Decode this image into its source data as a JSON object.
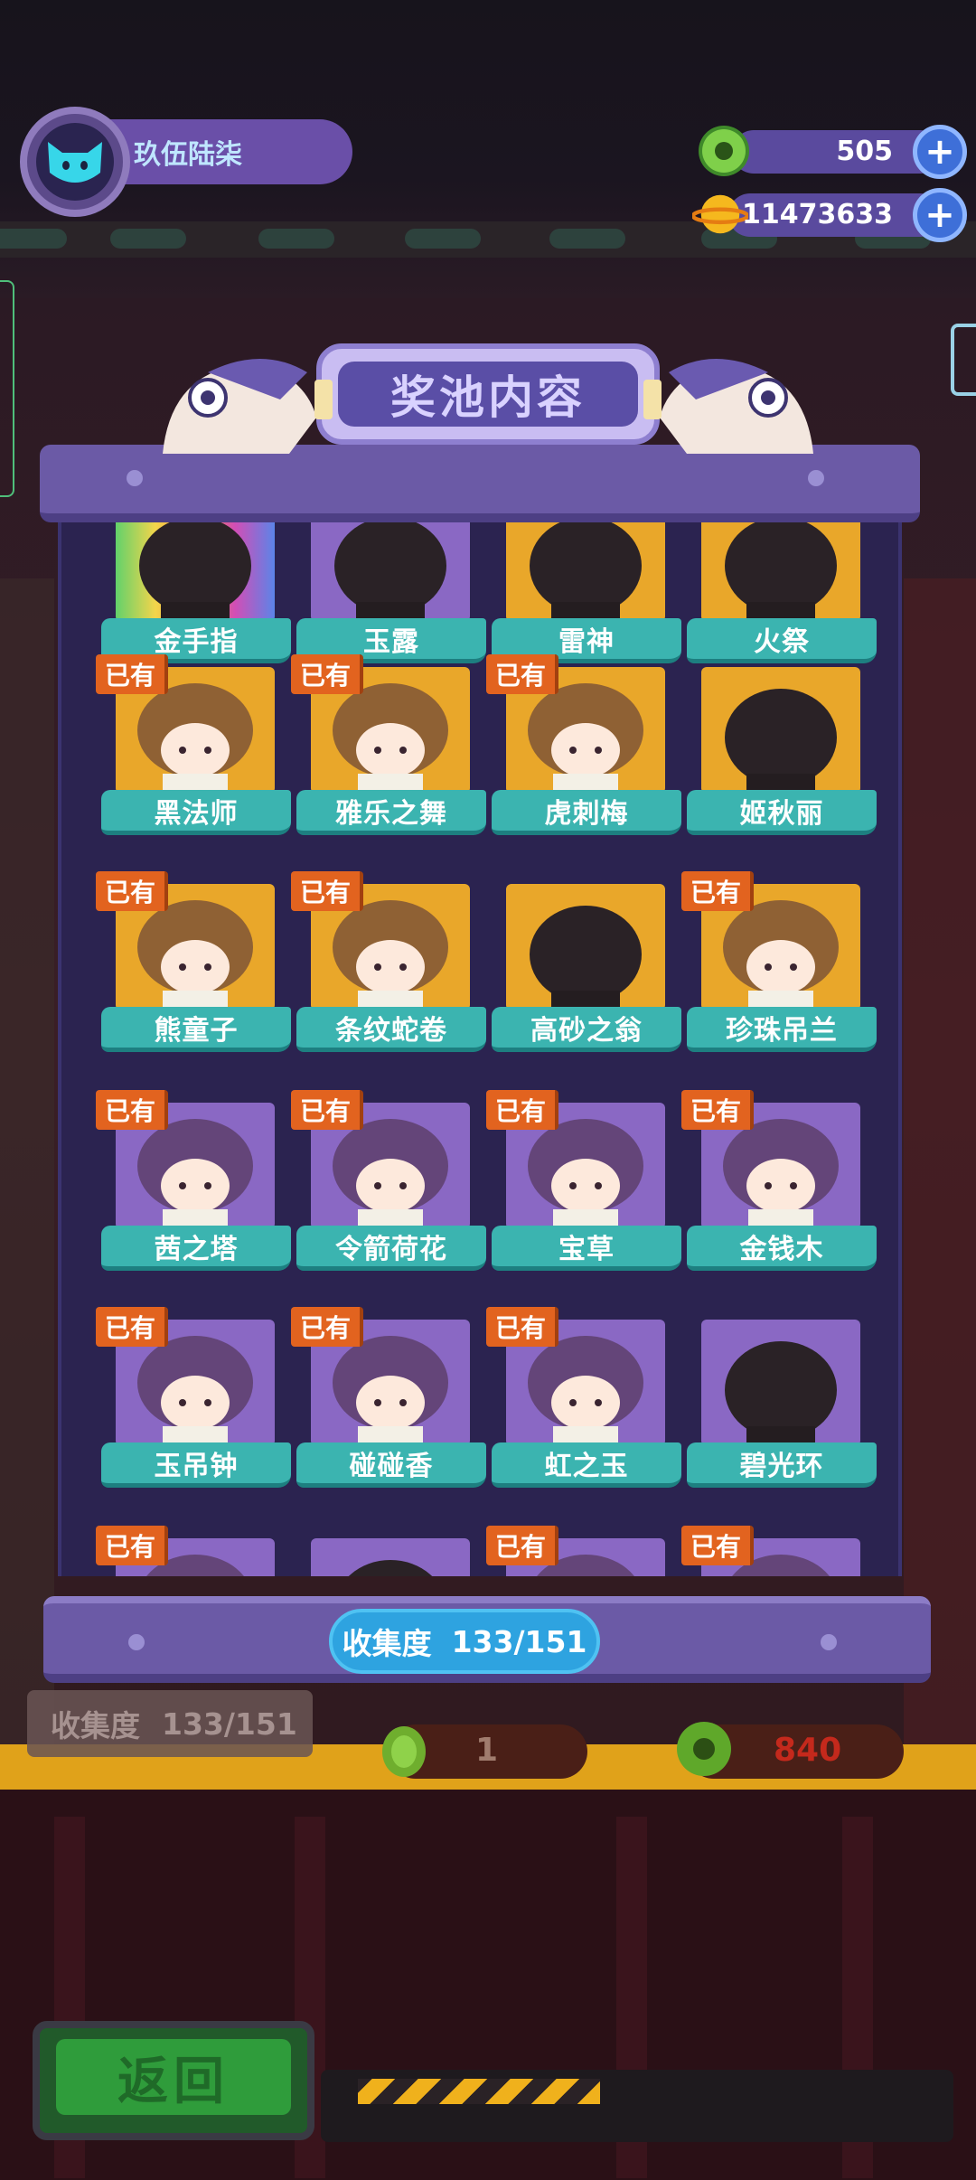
{
  "header": {
    "player_name": "玖伍陆柒",
    "currencies": [
      {
        "icon": "green-donut-coin-icon",
        "value": "505"
      },
      {
        "icon": "golden-planet-coin-icon",
        "value": "11473633"
      }
    ]
  },
  "panel": {
    "title": "奖池内容",
    "owned_badge": "已有",
    "rows": [
      [
        {
          "name": "金手指",
          "bg": "rainbow",
          "owned": false
        },
        {
          "name": "玉露",
          "bg": "purple",
          "owned": false
        },
        {
          "name": "雷神",
          "bg": "gold",
          "owned": false
        },
        {
          "name": "火祭",
          "bg": "gold",
          "owned": false
        }
      ],
      [
        {
          "name": "黑法师",
          "bg": "gold",
          "owned": true
        },
        {
          "name": "雅乐之舞",
          "bg": "gold",
          "owned": true
        },
        {
          "name": "虎刺梅",
          "bg": "gold",
          "owned": true
        },
        {
          "name": "姬秋丽",
          "bg": "gold",
          "owned": false
        }
      ],
      [
        {
          "name": "熊童子",
          "bg": "gold",
          "owned": true
        },
        {
          "name": "条纹蛇卷",
          "bg": "gold",
          "owned": true
        },
        {
          "name": "高砂之翁",
          "bg": "gold",
          "owned": false
        },
        {
          "name": "珍珠吊兰",
          "bg": "gold",
          "owned": true
        }
      ],
      [
        {
          "name": "茜之塔",
          "bg": "purple",
          "owned": true
        },
        {
          "name": "令箭荷花",
          "bg": "purple",
          "owned": true
        },
        {
          "name": "宝草",
          "bg": "purple",
          "owned": true
        },
        {
          "name": "金钱木",
          "bg": "purple",
          "owned": true
        }
      ],
      [
        {
          "name": "玉吊钟",
          "bg": "purple",
          "owned": true
        },
        {
          "name": "碰碰香",
          "bg": "purple",
          "owned": true
        },
        {
          "name": "虹之玉",
          "bg": "purple",
          "owned": true
        },
        {
          "name": "碧光环",
          "bg": "purple",
          "owned": false
        }
      ],
      [
        {
          "name": "",
          "bg": "purple",
          "owned": true
        },
        {
          "name": "",
          "bg": "purple",
          "owned": false
        },
        {
          "name": "",
          "bg": "purple",
          "owned": true
        },
        {
          "name": "",
          "bg": "purple",
          "owned": true
        }
      ]
    ],
    "collection_label": "收集度",
    "collection_value": "133/151"
  },
  "background": {
    "collection_label": "收集度",
    "collection_value": "133/151",
    "price_single": "1",
    "price_multi": "840"
  },
  "footer": {
    "back_label": "返回"
  },
  "colors": {
    "card_label": "#3bb4b0",
    "owned_badge": "#e2631f",
    "gold_bg": "#e9a72a",
    "purple_bg": "#8a68c4",
    "panel": "#6b5aa6",
    "collect_pill": "#2ea3e0"
  }
}
